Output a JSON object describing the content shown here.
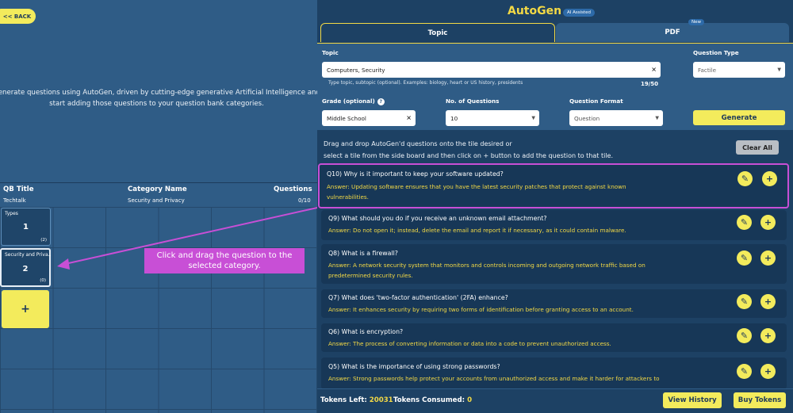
{
  "left": {
    "back_label": "<< BACK",
    "intro_line1": "Generate questions using AutoGen, driven by cutting-edge generative Artificial Intelligence and",
    "intro_line2": "start adding those questions to your question bank categories.",
    "table": {
      "headers": {
        "qb_title": "QB Title",
        "category_name": "Category Name",
        "questions": "Questions"
      },
      "row": {
        "qb_title": "Techtalk",
        "category_name": "Security and Privacy",
        "questions": "0/10"
      }
    },
    "tiles": [
      {
        "title": "Types",
        "number": "1",
        "count": "(2)"
      },
      {
        "title": "Security and Priva...",
        "number": "2",
        "count": "(0)"
      }
    ],
    "add_tile_label": "+",
    "callout": "Click and drag the question to the selected category."
  },
  "right": {
    "app_title": "AutoGen",
    "ai_badge": "AI Assisted",
    "tabs": {
      "topic": "Topic",
      "pdf": "PDF",
      "new_badge": "New"
    },
    "form": {
      "topic_label": "Topic",
      "topic_value": "Computers, Security",
      "topic_hint": "Type topic, subtopic (optional). Examples: biology, heart or US history, presidents",
      "topic_count": "19/50",
      "question_type_label": "Question Type",
      "question_type_value": "Factile",
      "grade_label": "Grade (optional)",
      "grade_value": "Middle School",
      "num_questions_label": "No. of Questions",
      "num_questions_value": "10",
      "format_label": "Question Format",
      "format_value": "Question",
      "generate_label": "Generate"
    },
    "instructions_line1": "Drag and drop AutoGen'd questions onto the tile desired or",
    "instructions_line2": "select a tile from the side board and then click on + button to add the question to that tile.",
    "clear_all_label": "Clear All",
    "questions": [
      {
        "q": "Q10) Why is it important to keep your software updated?",
        "a1": "Answer: Updating software ensures that you have the latest security patches that protect against known",
        "a2": "vulnerabilities."
      },
      {
        "q": "Q9) What should you do if you receive an unknown email attachment?",
        "a1": "Answer: Do not open it; instead, delete the email and report it if necessary, as it could contain malware.",
        "a2": ""
      },
      {
        "q": "Q8) What is a firewall?",
        "a1": "Answer: A network security system that monitors and controls incoming and outgoing network traffic based on",
        "a2": "predetermined security rules."
      },
      {
        "q": "Q7) What does 'two-factor authentication' (2FA) enhance?",
        "a1": "Answer: It enhances security by requiring two forms of identification before granting access to an account.",
        "a2": ""
      },
      {
        "q": "Q6) What is encryption?",
        "a1": "Answer: The process of converting information or data into a code to prevent unauthorized access.",
        "a2": ""
      },
      {
        "q": "Q5) What is the importance of using strong passwords?",
        "a1": "Answer: Strong passwords help protect your accounts from unauthorized access and make it harder for attackers to",
        "a2": ""
      }
    ],
    "footer": {
      "tokens_left_label": "Tokens Left:",
      "tokens_left_value": "20031",
      "tokens_consumed_label": "Tokens Consumed:",
      "tokens_consumed_value": "0",
      "view_history_label": "View History",
      "buy_tokens_label": "Buy Tokens"
    }
  },
  "colors": {
    "accent_yellow": "#f3eb5c",
    "title_gold": "#f3d945",
    "panel_blue": "#2f5c86",
    "dark_blue": "#1d4164",
    "highlight_magenta": "#c84fd6"
  },
  "icons": {
    "edit": "edit-icon",
    "add": "plus-icon",
    "clear_field": "close-icon",
    "dropdown": "chevron-down-icon",
    "help": "help-icon"
  }
}
